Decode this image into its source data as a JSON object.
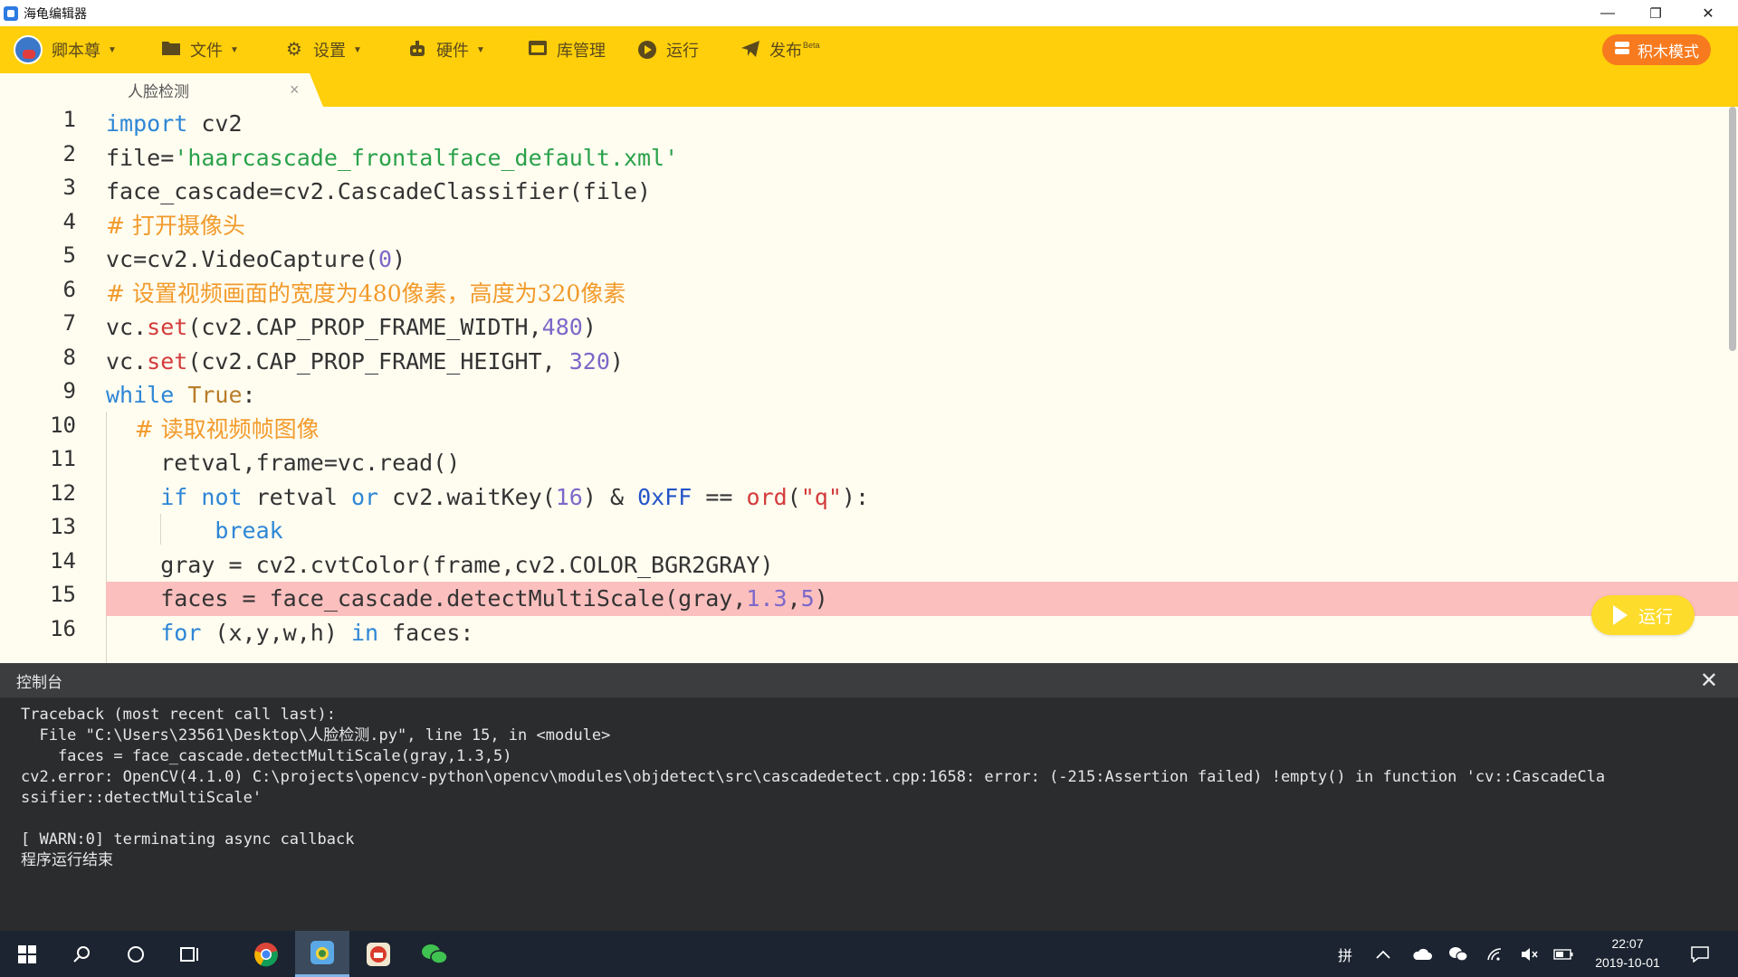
{
  "window": {
    "title": "海龟编辑器",
    "minimize": "—",
    "maximize": "❐",
    "close": "✕"
  },
  "toolbar": {
    "user": "卿本尊",
    "file": "文件",
    "settings": "设置",
    "hardware": "硬件",
    "library": "库管理",
    "run": "运行",
    "publish": "发布",
    "publish_badge": "Beta",
    "block_mode": "积木模式"
  },
  "tab": {
    "label": "人脸检测",
    "close": "×"
  },
  "editor": {
    "line_numbers": [
      "1",
      "2",
      "3",
      "4",
      "5",
      "6",
      "7",
      "8",
      "9",
      "10",
      "11",
      "12",
      "13",
      "14",
      "15",
      "16"
    ],
    "error_line": 15,
    "run_button": "运行"
  },
  "console": {
    "title": "控制台",
    "close": "✕",
    "lines": [
      "Traceback (most recent call last):",
      "  File \"C:\\Users\\23561\\Desktop\\人脸检测.py\", line 15, in <module>",
      "    faces = face_cascade.detectMultiScale(gray,1.3,5)",
      "cv2.error: OpenCV(4.1.0) C:\\projects\\opencv-python\\opencv\\modules\\objdetect\\src\\cascadedetect.cpp:1658: error: (-215:Assertion failed) !empty() in function 'cv::CascadeCla",
      "ssifier::detectMultiScale'",
      "",
      "[ WARN:0] terminating async callback",
      "程序运行结束"
    ]
  },
  "taskbar": {
    "time": "22:07",
    "date": "2019-10-01",
    "ime": "拼"
  },
  "colors": {
    "toolbar": "#fecf0a",
    "editor_bg": "#fffdf0",
    "error_line": "#fbbfbe",
    "block_mode_button": "#f77a1f",
    "console_bg": "#2a2c2e",
    "taskbar": "#1b2430"
  }
}
